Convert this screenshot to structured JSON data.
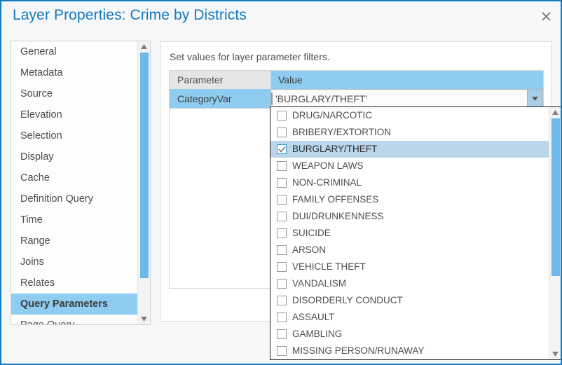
{
  "dialog": {
    "title": "Layer Properties: Crime by Districts",
    "close_icon": "close-icon"
  },
  "sidebar": {
    "items": [
      {
        "label": "General",
        "selected": false
      },
      {
        "label": "Metadata",
        "selected": false
      },
      {
        "label": "Source",
        "selected": false
      },
      {
        "label": "Elevation",
        "selected": false
      },
      {
        "label": "Selection",
        "selected": false
      },
      {
        "label": "Display",
        "selected": false
      },
      {
        "label": "Cache",
        "selected": false
      },
      {
        "label": "Definition Query",
        "selected": false
      },
      {
        "label": "Time",
        "selected": false
      },
      {
        "label": "Range",
        "selected": false
      },
      {
        "label": "Joins",
        "selected": false
      },
      {
        "label": "Relates",
        "selected": false
      },
      {
        "label": "Query Parameters",
        "selected": true
      },
      {
        "label": "Page Query",
        "selected": false
      }
    ],
    "scroll_up_icon": "triangle-up-icon",
    "scroll_down_icon": "triangle-down-icon"
  },
  "main": {
    "hint": "Set values for layer parameter filters.",
    "table": {
      "headers": [
        "Parameter",
        "Value"
      ],
      "rows": [
        {
          "parameter": "CategoryVar",
          "value": "'BURGLARY/THEFT'"
        }
      ]
    },
    "combo_arrow_icon": "chevron-down-icon"
  },
  "dropdown": {
    "options": [
      {
        "label": "DRUG/NARCOTIC",
        "checked": false
      },
      {
        "label": "BRIBERY/EXTORTION",
        "checked": false
      },
      {
        "label": "BURGLARY/THEFT",
        "checked": true
      },
      {
        "label": "WEAPON LAWS",
        "checked": false
      },
      {
        "label": "NON-CRIMINAL",
        "checked": false
      },
      {
        "label": "FAMILY OFFENSES",
        "checked": false
      },
      {
        "label": "DUI/DRUNKENNESS",
        "checked": false
      },
      {
        "label": "SUICIDE",
        "checked": false
      },
      {
        "label": "ARSON",
        "checked": false
      },
      {
        "label": "VEHICLE THEFT",
        "checked": false
      },
      {
        "label": "VANDALISM",
        "checked": false
      },
      {
        "label": "DISORDERLY CONDUCT",
        "checked": false
      },
      {
        "label": "ASSAULT",
        "checked": false
      },
      {
        "label": "GAMBLING",
        "checked": false
      },
      {
        "label": "MISSING PERSON/RUNAWAY",
        "checked": false
      }
    ],
    "scroll_up_icon": "triangle-up-icon",
    "scroll_down_icon": "triangle-down-icon"
  },
  "colors": {
    "frame": "#1379bf",
    "title": "#1379bf",
    "accent_light": "#8ecdf0",
    "selection": "#b9d6ea",
    "scroll_thumb": "#6cb8e8",
    "header_gray": "#e5e5e5"
  }
}
